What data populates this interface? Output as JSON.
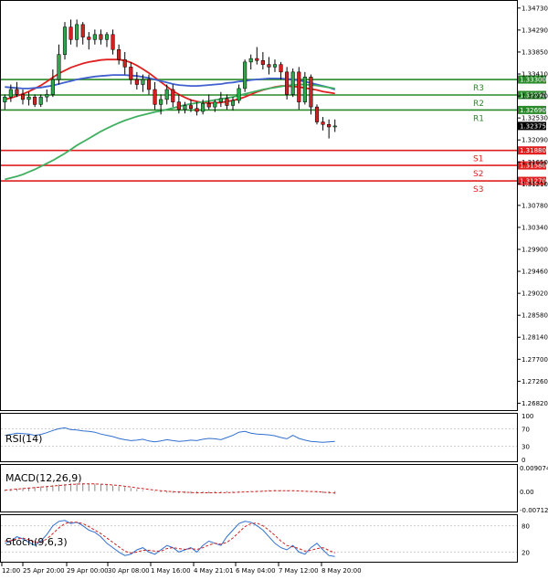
{
  "chart_data": {
    "type": "candlestick",
    "symbol_close_tag": "1.32375",
    "price_axis_ticks": [
      "1.34730",
      "1.34290",
      "1.33850",
      "1.33410",
      "1.32970",
      "1.32530",
      "1.32090",
      "1.31650",
      "1.31210",
      "1.30780",
      "1.30340",
      "1.29900",
      "1.29460",
      "1.29020",
      "1.28580",
      "1.28140",
      "1.27700",
      "1.27260",
      "1.26820"
    ],
    "price_range": [
      1.267,
      1.348
    ],
    "time_labels": [
      "12:00",
      "25 Apr 20:00",
      "29 Apr 00:00",
      "30 Apr 08:00",
      "1 May 16:00",
      "4 May 21:01",
      "6 May 04:00",
      "7 May 12:00",
      "8 May 20:00"
    ],
    "candles": [
      [
        1.3285,
        1.33,
        1.327,
        1.3295
      ],
      [
        1.3295,
        1.332,
        1.3285,
        1.331
      ],
      [
        1.331,
        1.3325,
        1.3295,
        1.33
      ],
      [
        1.33,
        1.331,
        1.328,
        1.329
      ],
      [
        1.329,
        1.3305,
        1.3278,
        1.3295
      ],
      [
        1.3295,
        1.33,
        1.3275,
        1.328
      ],
      [
        1.328,
        1.33,
        1.3275,
        1.3295
      ],
      [
        1.3295,
        1.331,
        1.3285,
        1.33
      ],
      [
        1.33,
        1.335,
        1.3295,
        1.333
      ],
      [
        1.333,
        1.34,
        1.332,
        1.338
      ],
      [
        1.338,
        1.3445,
        1.337,
        1.3435
      ],
      [
        1.3435,
        1.345,
        1.34,
        1.341
      ],
      [
        1.341,
        1.345,
        1.3395,
        1.344
      ],
      [
        1.344,
        1.3445,
        1.34,
        1.3415
      ],
      [
        1.3415,
        1.3425,
        1.339,
        1.341
      ],
      [
        1.341,
        1.343,
        1.34,
        1.342
      ],
      [
        1.342,
        1.343,
        1.34,
        1.341
      ],
      [
        1.341,
        1.3425,
        1.3395,
        1.342
      ],
      [
        1.342,
        1.343,
        1.338,
        1.339
      ],
      [
        1.339,
        1.34,
        1.336,
        1.337
      ],
      [
        1.337,
        1.3385,
        1.334,
        1.3355
      ],
      [
        1.3355,
        1.3365,
        1.332,
        1.333
      ],
      [
        1.333,
        1.3345,
        1.331,
        1.332
      ],
      [
        1.332,
        1.334,
        1.3305,
        1.333
      ],
      [
        1.333,
        1.334,
        1.33,
        1.331
      ],
      [
        1.331,
        1.3325,
        1.327,
        1.328
      ],
      [
        1.328,
        1.33,
        1.326,
        1.329
      ],
      [
        1.329,
        1.332,
        1.328,
        1.331
      ],
      [
        1.331,
        1.332,
        1.3275,
        1.3285
      ],
      [
        1.3285,
        1.33,
        1.3262,
        1.327
      ],
      [
        1.327,
        1.3285,
        1.3262,
        1.3278
      ],
      [
        1.3278,
        1.329,
        1.3265,
        1.3272
      ],
      [
        1.3272,
        1.3285,
        1.3258,
        1.3266
      ],
      [
        1.3266,
        1.329,
        1.326,
        1.3282
      ],
      [
        1.3282,
        1.33,
        1.327,
        1.3275
      ],
      [
        1.3275,
        1.329,
        1.3265,
        1.3285
      ],
      [
        1.3285,
        1.3305,
        1.3275,
        1.3292
      ],
      [
        1.3292,
        1.33,
        1.327,
        1.3278
      ],
      [
        1.3278,
        1.3295,
        1.3268,
        1.3288
      ],
      [
        1.3288,
        1.332,
        1.3282,
        1.3312
      ],
      [
        1.3312,
        1.337,
        1.3305,
        1.3365
      ],
      [
        1.3365,
        1.338,
        1.335,
        1.3372
      ],
      [
        1.3372,
        1.3395,
        1.336,
        1.3368
      ],
      [
        1.3368,
        1.3385,
        1.335,
        1.336
      ],
      [
        1.336,
        1.3375,
        1.334,
        1.3355
      ],
      [
        1.3355,
        1.337,
        1.3345,
        1.336
      ],
      [
        1.336,
        1.3365,
        1.333,
        1.3345
      ],
      [
        1.3345,
        1.3355,
        1.329,
        1.33
      ],
      [
        1.33,
        1.3352,
        1.3295,
        1.3345
      ],
      [
        1.3345,
        1.3355,
        1.327,
        1.3285
      ],
      [
        1.3285,
        1.3345,
        1.328,
        1.3335
      ],
      [
        1.3335,
        1.334,
        1.326,
        1.3275
      ],
      [
        1.3275,
        1.328,
        1.324,
        1.3245
      ],
      [
        1.3245,
        1.3255,
        1.3228,
        1.324
      ],
      [
        1.324,
        1.325,
        1.3212,
        1.3235
      ],
      [
        1.3235,
        1.325,
        1.3225,
        1.3237
      ]
    ],
    "moving_averages": [
      {
        "color": "#e02020",
        "values": [
          1.329,
          1.3293,
          1.3297,
          1.3301,
          1.3306,
          1.3312,
          1.3318,
          1.3326,
          1.3334,
          1.3342,
          1.3348,
          1.3354,
          1.3358,
          1.3362,
          1.3365,
          1.3367,
          1.3369,
          1.337,
          1.337,
          1.337,
          1.3368,
          1.3364,
          1.3358,
          1.3351,
          1.3343,
          1.3334,
          1.3325,
          1.3316,
          1.3307,
          1.33,
          1.3294,
          1.3289,
          1.3286,
          1.3284,
          1.3283,
          1.3283,
          1.3284,
          1.3286,
          1.3288,
          1.3291,
          1.3295,
          1.33,
          1.3305,
          1.3309,
          1.3312,
          1.3315,
          1.3317,
          1.3317,
          1.3316,
          1.3315,
          1.3313,
          1.3311,
          1.3309,
          1.3306,
          1.3304,
          1.3302
        ]
      },
      {
        "color": "#4060d0",
        "values": [
          1.3315,
          1.3314,
          1.3313,
          1.3312,
          1.3312,
          1.3313,
          1.3314,
          1.3316,
          1.3318,
          1.3321,
          1.3324,
          1.3327,
          1.333,
          1.3332,
          1.3334,
          1.3336,
          1.3337,
          1.3338,
          1.3339,
          1.3339,
          1.3339,
          1.3338,
          1.3337,
          1.3335,
          1.3333,
          1.333,
          1.3327,
          1.3324,
          1.3321,
          1.3319,
          1.3318,
          1.3317,
          1.3317,
          1.3318,
          1.3319,
          1.332,
          1.3321,
          1.3323,
          1.3324,
          1.3326,
          1.3327,
          1.3329,
          1.333,
          1.3331,
          1.3332,
          1.3332,
          1.3332,
          1.3331,
          1.333,
          1.3328,
          1.3326,
          1.3323,
          1.332,
          1.3317,
          1.3314,
          1.331
        ]
      },
      {
        "color": "#40b060",
        "values": [
          1.313,
          1.3133,
          1.3136,
          1.314,
          1.3145,
          1.315,
          1.3156,
          1.3162,
          1.3168,
          1.3175,
          1.3182,
          1.319,
          1.3198,
          1.3205,
          1.3212,
          1.3219,
          1.3226,
          1.3232,
          1.3238,
          1.3243,
          1.3248,
          1.3252,
          1.3256,
          1.3259,
          1.3262,
          1.3265,
          1.3267,
          1.327,
          1.3273,
          1.3276,
          1.3279,
          1.3281,
          1.3283,
          1.3285,
          1.3287,
          1.3289,
          1.3291,
          1.3293,
          1.3295,
          1.3298,
          1.3301,
          1.3304,
          1.3307,
          1.331,
          1.3312,
          1.3314,
          1.3316,
          1.3318,
          1.3319,
          1.332,
          1.332,
          1.3319,
          1.3318,
          1.3316,
          1.3314,
          1.3312
        ]
      }
    ],
    "levels": [
      {
        "name": "R3",
        "value": 1.333,
        "label": "1.33300",
        "color": "#2a8a2a"
      },
      {
        "name": "R2",
        "value": 1.3299,
        "label": "1.32990",
        "color": "#2a8a2a"
      },
      {
        "name": "R1",
        "value": 1.3269,
        "label": "1.32690",
        "color": "#2a8a2a"
      },
      {
        "name": "S1",
        "value": 1.3188,
        "label": "1.31880",
        "color": "#e02020"
      },
      {
        "name": "S2",
        "value": 1.3158,
        "label": "1.31580",
        "color": "#e02020"
      },
      {
        "name": "S3",
        "value": 1.3127,
        "label": "1.31270",
        "color": "#e02020"
      }
    ],
    "rsi": {
      "label": "RSI(14)",
      "ticks": [
        "100",
        "70",
        "30",
        "0"
      ],
      "values": [
        55,
        57,
        60,
        59,
        58,
        55,
        57,
        61,
        66,
        70,
        72,
        68,
        67,
        65,
        64,
        62,
        58,
        55,
        52,
        48,
        45,
        43,
        44,
        46,
        42,
        40,
        42,
        45,
        43,
        41,
        42,
        44,
        43,
        46,
        48,
        47,
        45,
        50,
        55,
        62,
        64,
        60,
        58,
        57,
        56,
        54,
        50,
        47,
        55,
        48,
        44,
        41,
        40,
        39,
        40,
        41
      ]
    },
    "macd": {
      "label": "MACD(12,26,9)",
      "ticks": [
        "0.009074",
        "0.00",
        "-0.007124"
      ],
      "histogram": [
        0.0005,
        0.0008,
        0.001,
        0.0012,
        0.0014,
        0.0016,
        0.0018,
        0.002,
        0.0023,
        0.0026,
        0.0028,
        0.003,
        0.0031,
        0.0031,
        0.003,
        0.0029,
        0.0027,
        0.0025,
        0.0022,
        0.0019,
        0.0016,
        0.0012,
        0.0008,
        0.0004,
        0.0001,
        -0.0002,
        -0.0004,
        -0.0006,
        -0.0007,
        -0.0008,
        -0.0008,
        -0.0009,
        -0.0009,
        -0.0008,
        -0.0008,
        -0.0007,
        -0.0006,
        -0.0005,
        -0.0004,
        -0.0003,
        -0.0001,
        0.0001,
        0.0002,
        0.0003,
        0.0004,
        0.0005,
        0.0004,
        0.0003,
        0.0002,
        0.0001,
        -0.0001,
        -0.0003,
        -0.0005,
        -0.0007,
        -0.0009,
        -0.0011
      ],
      "signal": [
        0.0004,
        0.0006,
        0.0008,
        0.001,
        0.0012,
        0.0014,
        0.0016,
        0.0018,
        0.002,
        0.0022,
        0.0024,
        0.0026,
        0.0027,
        0.0028,
        0.0028,
        0.0028,
        0.0027,
        0.0026,
        0.0024,
        0.0022,
        0.0019,
        0.0016,
        0.0013,
        0.001,
        0.0007,
        0.0004,
        0.0002,
        0.0,
        -0.0002,
        -0.0003,
        -0.0004,
        -0.0005,
        -0.0006,
        -0.0006,
        -0.0006,
        -0.0006,
        -0.0006,
        -0.0005,
        -0.0005,
        -0.0004,
        -0.0003,
        -0.0002,
        -0.0001,
        0.0,
        0.0001,
        0.0002,
        0.0002,
        0.0002,
        0.0002,
        0.0001,
        0.0,
        -0.0001,
        -0.0002,
        -0.0004,
        -0.0005,
        -0.0007
      ]
    },
    "stoch": {
      "label": "Stoch(9,6,3)",
      "ticks": [
        "80",
        "20"
      ],
      "main": [
        40,
        45,
        55,
        50,
        42,
        35,
        45,
        60,
        80,
        90,
        92,
        85,
        88,
        80,
        70,
        65,
        55,
        40,
        30,
        20,
        12,
        15,
        25,
        30,
        20,
        15,
        25,
        35,
        30,
        20,
        25,
        30,
        20,
        35,
        45,
        40,
        35,
        55,
        70,
        85,
        90,
        88,
        80,
        70,
        55,
        40,
        30,
        25,
        35,
        20,
        15,
        30,
        40,
        25,
        12,
        10
      ],
      "signal": [
        45,
        46,
        50,
        52,
        48,
        42,
        42,
        50,
        62,
        75,
        85,
        88,
        88,
        85,
        78,
        70,
        62,
        52,
        42,
        32,
        22,
        18,
        20,
        24,
        24,
        22,
        22,
        28,
        30,
        28,
        26,
        28,
        26,
        30,
        36,
        40,
        38,
        42,
        52,
        65,
        78,
        85,
        86,
        80,
        70,
        58,
        45,
        35,
        32,
        28,
        22,
        24,
        28,
        30,
        24,
        18
      ]
    }
  }
}
